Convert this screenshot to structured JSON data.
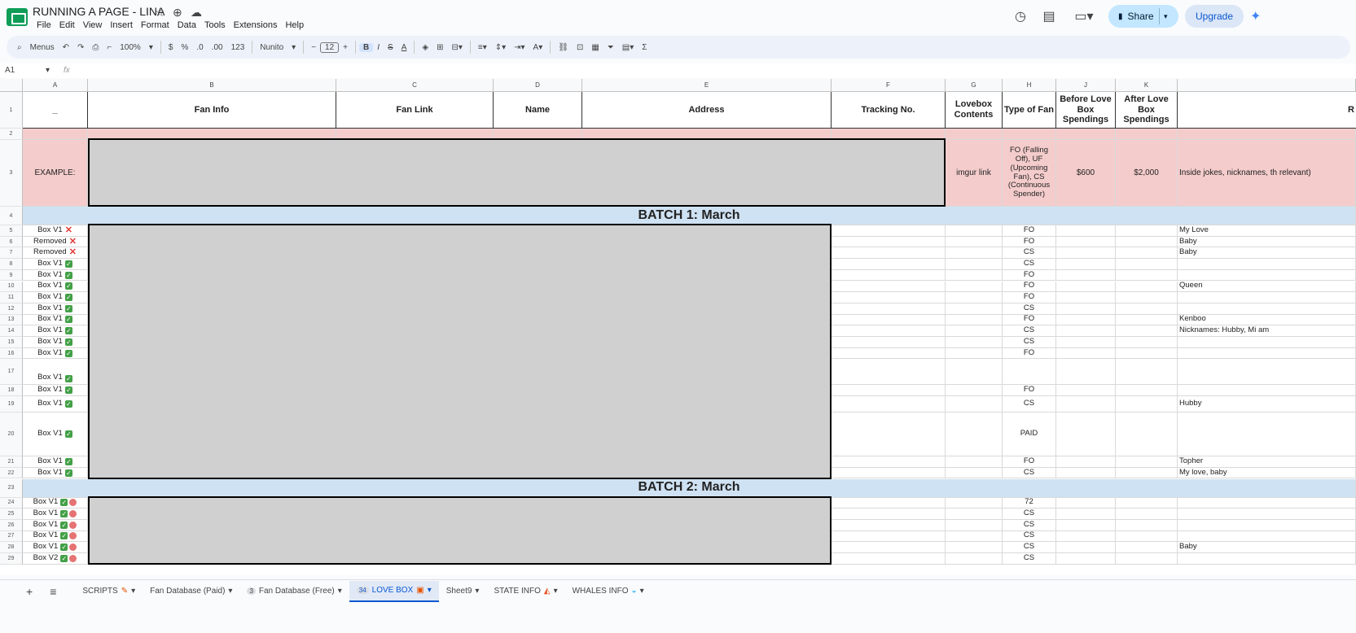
{
  "app": {
    "title": "RUNNING A PAGE - LINA",
    "menus": [
      "File",
      "Edit",
      "View",
      "Insert",
      "Format",
      "Data",
      "Tools",
      "Extensions",
      "Help"
    ],
    "share_label": "Share",
    "upgrade_label": "Upgrade"
  },
  "toolbar": {
    "menus_label": "Menus",
    "zoom": "100%",
    "currency": "$",
    "percent": "%",
    "dec_less": ".0",
    "dec_more": ".00",
    "num_format": "123",
    "font": "Nunito",
    "font_size": "12",
    "bold": "B",
    "italic": "I",
    "strike": "S",
    "text_color": "A"
  },
  "formula": {
    "cell_ref": "A1",
    "fx": "fx"
  },
  "columns": [
    "A",
    "B",
    "C",
    "D",
    "E",
    "F",
    "G",
    "H",
    "J",
    "K"
  ],
  "headers": {
    "a": "_",
    "b": "Fan Info",
    "c": "Fan Link",
    "d": "Name",
    "e": "Address",
    "f": "Tracking No.",
    "g": "Lovebox Contents",
    "h": "Type of Fan",
    "j": "Before Love Box Spendings",
    "k": "After Love Box Spendings",
    "l": "R"
  },
  "example": {
    "a": "EXAMPLE:",
    "g": "imgur link",
    "h": "FO (Falling Off), UF (Upcoming Fan), CS (Continuous Spender)",
    "j": "$600",
    "k": "$2,000",
    "l": "Inside jokes, nicknames, th relevant)"
  },
  "batches": [
    {
      "title": "BATCH 1: March"
    },
    {
      "title": "BATCH 2: March"
    }
  ],
  "rows": [
    {
      "num": "5",
      "status": "Box V1",
      "mark": "x",
      "type": "FO",
      "note": "My Love"
    },
    {
      "num": "6",
      "status": "Removed",
      "mark": "x",
      "type": "FO",
      "note": "Baby"
    },
    {
      "num": "7",
      "status": "Removed",
      "mark": "x",
      "type": "CS",
      "note": "Baby"
    },
    {
      "num": "8",
      "status": "Box V1",
      "mark": "check",
      "type": "CS",
      "note": ""
    },
    {
      "num": "9",
      "status": "Box V1",
      "mark": "check",
      "type": "FO",
      "note": ""
    },
    {
      "num": "10",
      "status": "Box V1",
      "mark": "check",
      "type": "FO",
      "note": "Queen"
    },
    {
      "num": "11",
      "status": "Box V1",
      "mark": "check",
      "type": "FO",
      "note": ""
    },
    {
      "num": "12",
      "status": "Box V1",
      "mark": "check",
      "type": "CS",
      "note": ""
    },
    {
      "num": "13",
      "status": "Box V1",
      "mark": "check",
      "type": "FO",
      "note": "Kenboo"
    },
    {
      "num": "14",
      "status": "Box V1",
      "mark": "check",
      "type": "CS",
      "note": "Nicknames: Hubby, Mi am"
    },
    {
      "num": "15",
      "status": "Box V1",
      "mark": "check",
      "type": "CS",
      "note": ""
    },
    {
      "num": "16",
      "status": "Box V1",
      "mark": "check",
      "type": "FO",
      "note": ""
    },
    {
      "num": "17",
      "status": "Box V1",
      "mark": "check",
      "type": "",
      "note": ""
    },
    {
      "num": "18",
      "status": "Box V1",
      "mark": "check",
      "type": "FO",
      "note": ""
    },
    {
      "num": "19",
      "status": "Box V1",
      "mark": "check",
      "type": "CS",
      "note": "Hubby"
    },
    {
      "num": "20",
      "status": "Box V1",
      "mark": "check",
      "type": "PAID",
      "note": ""
    },
    {
      "num": "21",
      "status": "Box V1",
      "mark": "check",
      "type": "FO",
      "note": "Topher"
    },
    {
      "num": "22",
      "status": "Box V1",
      "mark": "check",
      "type": "CS",
      "note": "My love, baby"
    },
    {
      "num": "24",
      "status": "Box V1",
      "mark": "check-dot",
      "type": "72",
      "note": ""
    },
    {
      "num": "25",
      "status": "Box V1",
      "mark": "check-dot",
      "type": "CS",
      "note": ""
    },
    {
      "num": "26",
      "status": "Box V1",
      "mark": "check-dot",
      "type": "CS",
      "note": ""
    },
    {
      "num": "27",
      "status": "Box V1",
      "mark": "check-dot",
      "type": "CS",
      "note": ""
    },
    {
      "num": "28",
      "status": "Box V1",
      "mark": "check-dot",
      "type": "CS",
      "note": "Baby"
    },
    {
      "num": "29",
      "status": "Box V2",
      "mark": "check-dot",
      "type": "CS",
      "note": ""
    }
  ],
  "row_numbers": {
    "header": "1",
    "r2": "2",
    "r3": "3",
    "r4": "4",
    "r23": "23"
  },
  "sheets": [
    {
      "label": "SCRIPTS",
      "icon": "pencil-icon"
    },
    {
      "label": "Fan Database (Paid)",
      "icon": ""
    },
    {
      "label": "Fan Database (Free)",
      "count": "3"
    },
    {
      "label": "LOVE BOX",
      "count": "34",
      "active": true
    },
    {
      "label": "Sheet9"
    },
    {
      "label": "STATE INFO"
    },
    {
      "label": "WHALES INFO"
    }
  ]
}
